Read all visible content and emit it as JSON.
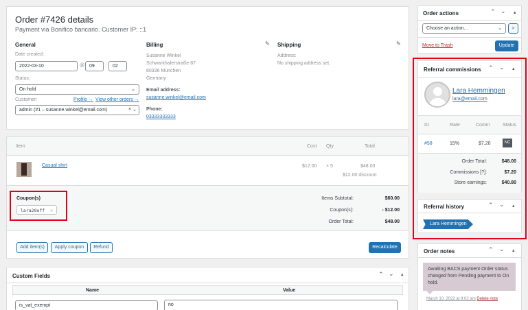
{
  "order": {
    "title": "Order #7426 details",
    "subtitle": "Payment via Bonifico bancario. Customer IP: ::1",
    "general": {
      "heading": "General",
      "date_label": "Date created:",
      "date": "2022-03-10",
      "at": "@",
      "hour": "09",
      "colon": ":",
      "minute": "02",
      "status_label": "Status:",
      "status": "On hold",
      "customer_label": "Customer:",
      "profile_link": "Profile →",
      "other_orders_link": "View other orders →",
      "customer": "admin (#1 – susanne.winkel@email.com)"
    },
    "billing": {
      "heading": "Billing",
      "name": "Susanne Winkel",
      "street": "Schwanthalerstraße 87",
      "city": "80336 München",
      "country": "Germany",
      "email_label": "Email address:",
      "email": "susanne.winkel@email.com",
      "phone_label": "Phone:",
      "phone": "03333333333"
    },
    "shipping": {
      "heading": "Shipping",
      "address_label": "Address:",
      "address": "No shipping address set."
    }
  },
  "items": {
    "headers": {
      "item": "Item",
      "cost": "Cost",
      "qty": "Qty",
      "total": "Total"
    },
    "rows": [
      {
        "name": "Casual shirt",
        "cost": "$12.00",
        "qty": "× 5",
        "total": "$48.00",
        "discount": "$12.00 discount"
      }
    ],
    "coupons_label": "Coupon(s)",
    "coupon_code": "lara20off",
    "coupon_remove": "×",
    "totals": {
      "subtotal_label": "Items Subtotal:",
      "subtotal": "$60.00",
      "coupons_label": "Coupon(s):",
      "coupons": "- $12.00",
      "order_total_label": "Order Total:",
      "order_total": "$48.00"
    },
    "buttons": {
      "add_items": "Add item(s)",
      "apply_coupon": "Apply coupon",
      "refund": "Refund",
      "recalculate": "Recalculate"
    }
  },
  "custom_fields": {
    "title": "Custom Fields",
    "name_header": "Name",
    "value_header": "Value",
    "rows": [
      {
        "name": "is_vat_exempt",
        "value": "no"
      }
    ]
  },
  "sidebar": {
    "order_actions": {
      "title": "Order actions",
      "select": "Choose an action...",
      "go": ">",
      "trash": "Move to Trash",
      "update": "Update"
    },
    "referral_commissions": {
      "title": "Referral commissions",
      "affiliate_name": "Lara Hemmingen",
      "affiliate_email": "lara@email.com",
      "headers": {
        "id": "ID",
        "rate": "Rate",
        "comm": "Comm",
        "status": "Status"
      },
      "row": {
        "id": "#58",
        "rate": "15%",
        "comm": "$7.20",
        "status": "NC"
      },
      "order_total_label": "Order Total:",
      "order_total": "$48.00",
      "commissions_label": "Commissions [?]:",
      "commissions": "$7.20",
      "store_earnings_label": "Store earnings:",
      "store_earnings": "$40.80"
    },
    "referral_history": {
      "title": "Referral history",
      "entry": "Lara Hemmingen"
    },
    "order_notes": {
      "title": "Order notes",
      "note": "Awaiting BACS payment Order status changed from Pending payment to On hold.",
      "meta": "March 10, 2022 at 9:02 am",
      "delete": "Delete note"
    }
  },
  "colors": {
    "accent": "#2271b1",
    "highlight": "#e0001b",
    "note_bg": "#d7cad2",
    "trash": "#b32d2e"
  }
}
